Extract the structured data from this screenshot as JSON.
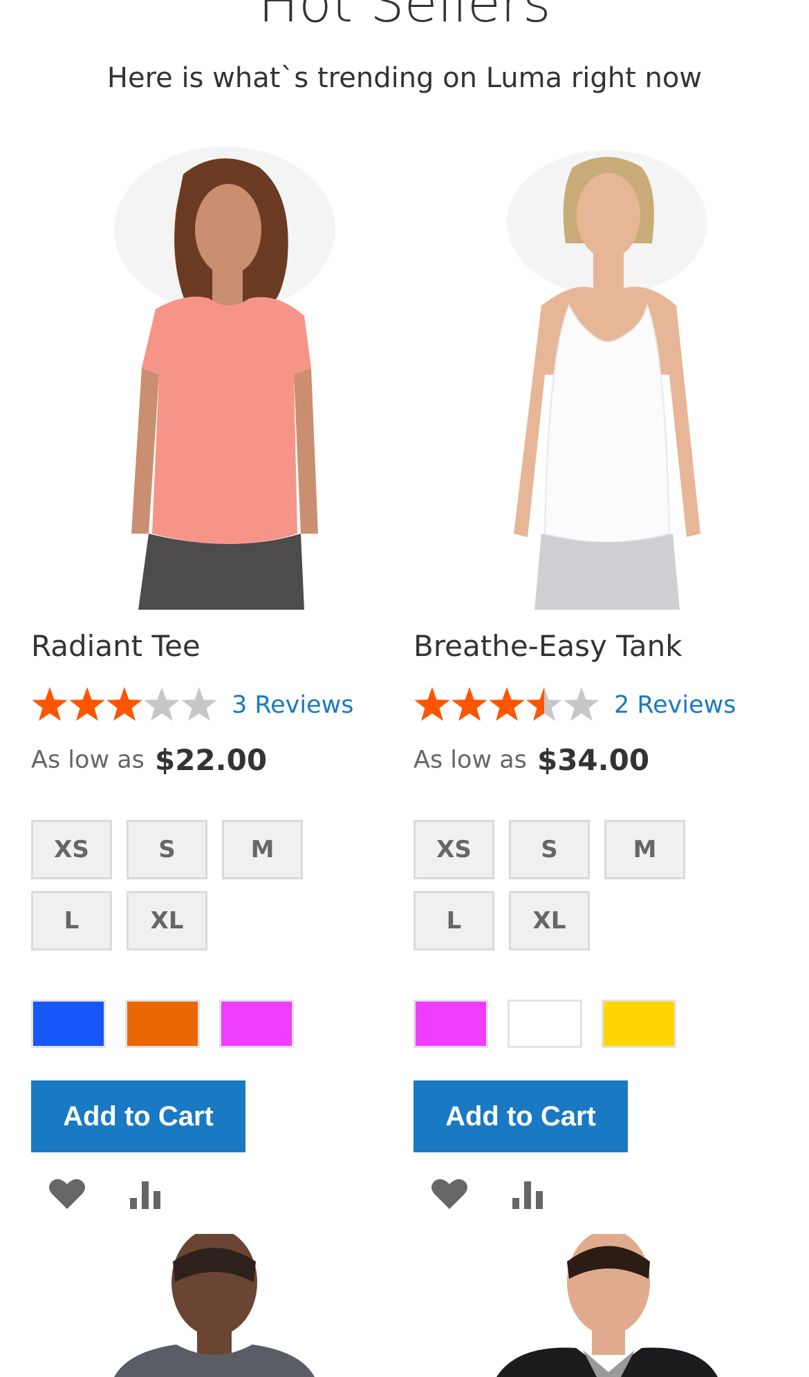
{
  "header": {
    "title": "Hot Sellers",
    "subtitle": "Here is what`s trending on Luma right now"
  },
  "products": [
    {
      "name": "Radiant Tee",
      "rating_percent": 60,
      "reviews": "3 Reviews",
      "price_label": "As low as",
      "price": "$22.00",
      "sizes": [
        "XS",
        "S",
        "M",
        "L",
        "XL"
      ],
      "colors": [
        "#1857f7",
        "#eb6703",
        "#ef3dff"
      ],
      "add_to_cart": "Add to Cart"
    },
    {
      "name": "Breathe-Easy Tank",
      "rating_percent": 70,
      "reviews": "2 Reviews",
      "price_label": "As low as",
      "price": "$34.00",
      "sizes": [
        "XS",
        "S",
        "M",
        "L",
        "XL"
      ],
      "colors": [
        "#ef3dff",
        "#ffffff",
        "#ffd500"
      ],
      "add_to_cart": "Add to Cart"
    }
  ],
  "colors": {
    "accent": "#1979c3",
    "star_filled": "#ff5501",
    "star_empty": "#c7c7c7"
  }
}
